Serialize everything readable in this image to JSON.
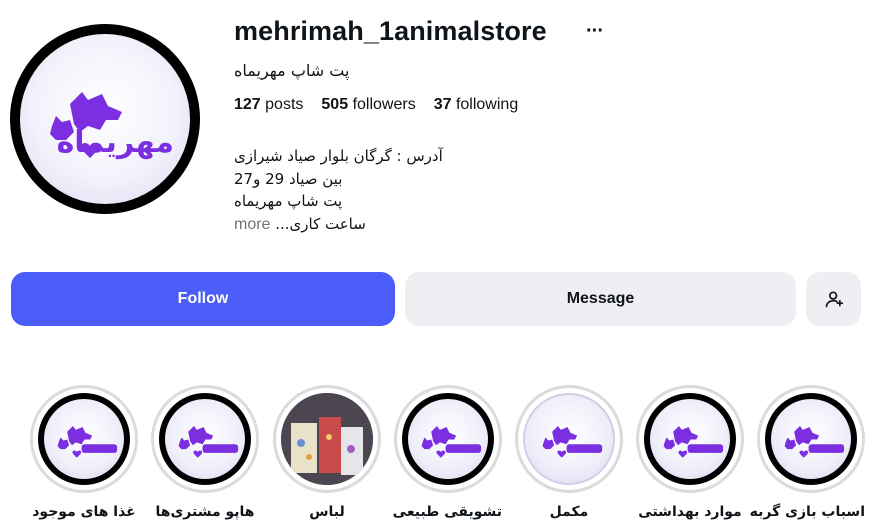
{
  "profile": {
    "username": "mehrimah_1animalstore",
    "full_name": "پت شاپ مهریماه",
    "avatar_logo_text": "مهریماه",
    "more_icon": "more-horizontal-icon"
  },
  "stats": {
    "posts_count": "127",
    "posts_label": "posts",
    "followers_count": "505",
    "followers_label": "followers",
    "following_count": "37",
    "following_label": "following"
  },
  "bio": {
    "line1": "آدرس : گرگان بلوار صیاد شیرازی",
    "line2": "بین صیاد 29 و27",
    "line3": "پت شاپ مهریماه",
    "line4": "ساعت کاری...",
    "more_label": "more"
  },
  "actions": {
    "follow_label": "Follow",
    "message_label": "Message",
    "add_user_icon": "person-add-icon"
  },
  "highlights": [
    {
      "label": "اسباب بازی گربه",
      "type": "logo"
    },
    {
      "label": "موارد بهداشتی",
      "type": "logo"
    },
    {
      "label": "مکمل",
      "type": "logo-plain"
    },
    {
      "label": "تشویقی طبیعی",
      "type": "logo"
    },
    {
      "label": "لباس",
      "type": "photo"
    },
    {
      "label": "هاپو مشتری‌ها",
      "type": "logo"
    },
    {
      "label": "غذا های موجود",
      "type": "logo"
    }
  ],
  "colors": {
    "follow_button": "#4a5df9",
    "secondary_button": "#efeff3",
    "brand_purple": "#7b2fe0",
    "muted_text": "#737373"
  }
}
